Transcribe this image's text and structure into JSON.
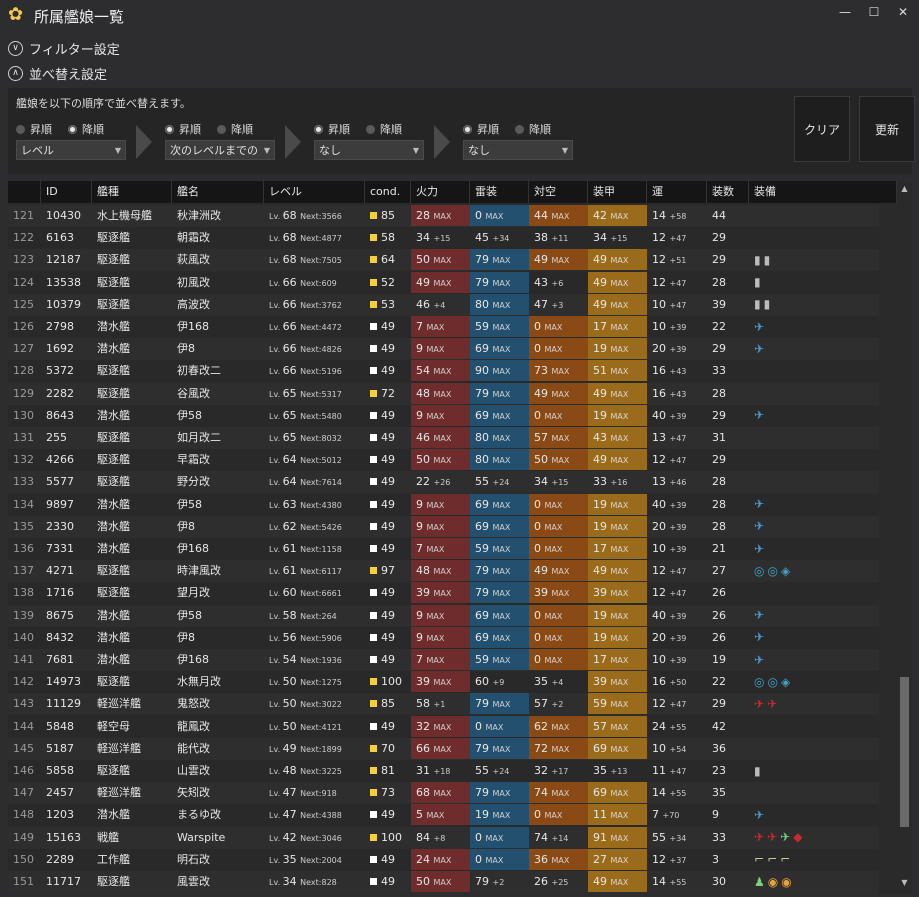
{
  "window": {
    "title": "所属艦娘一覧",
    "minimize": "—",
    "maximize": "☐",
    "close": "✕"
  },
  "filter_section": {
    "toggle": "∨",
    "label": "フィルター設定"
  },
  "sort_section": {
    "toggle": "∧",
    "label": "並べ替え設定",
    "description": "艦娘を以下の順序で並べ替えます。",
    "criteria": [
      {
        "asc": "昇順",
        "desc": "降順",
        "selected": "desc",
        "value": "レベル"
      },
      {
        "asc": "昇順",
        "desc": "降順",
        "selected": "asc",
        "value": "次のレベルまでの"
      },
      {
        "asc": "昇順",
        "desc": "降順",
        "selected": "asc",
        "value": "なし"
      },
      {
        "asc": "昇順",
        "desc": "降順",
        "selected": "asc",
        "value": "なし"
      }
    ],
    "clear_label": "クリア",
    "update_label": "更新"
  },
  "columns": [
    "",
    "ID",
    "艦種",
    "艦名",
    "レベル",
    "cond.",
    "火力",
    "雷装",
    "対空",
    "装甲",
    "運",
    "装数",
    "装備"
  ],
  "colors": {
    "red": "#6f2c2c",
    "blue": "#23506e",
    "orange": "#8a4a15",
    "gold": "#9b6b1c",
    "cond_yellow": "#f4d03f",
    "cond_white": "#ffffff",
    "gray_icon": "#bcbcbc",
    "sub_icon": "#4a9ed6",
    "fighter_icon": "#cc2b2b",
    "radar_icon": "#3fa6c7",
    "seaplane_icon": "#7ed07e",
    "aa_icon": "#e6a23c",
    "tp_icon": "#c7c79a"
  },
  "rows": [
    {
      "no": "121",
      "id": "10430",
      "type": "水上機母艦",
      "name": "秋津洲改",
      "lv": "68",
      "next": "3566",
      "cond": "85",
      "cc": "yellow",
      "fire": "28",
      "fire_s": "MAX",
      "fire_h": "red",
      "torp": "0",
      "torp_s": "MAX",
      "torp_h": "blue",
      "aa": "44",
      "aa_s": "MAX",
      "aa_h": "orange",
      "armor": "42",
      "armor_s": "MAX",
      "armor_h": "gold",
      "luck": "14",
      "luck_s": "+58",
      "slots": "44",
      "equip": []
    },
    {
      "no": "122",
      "id": "6163",
      "type": "駆逐艦",
      "name": "朝霜改",
      "lv": "68",
      "next": "4877",
      "cond": "58",
      "cc": "yellow",
      "fire": "34",
      "fire_s": "+15",
      "fire_h": "",
      "torp": "45",
      "torp_s": "+34",
      "torp_h": "",
      "aa": "38",
      "aa_s": "+11",
      "aa_h": "",
      "armor": "34",
      "armor_s": "+15",
      "armor_h": "",
      "luck": "12",
      "luck_s": "+47",
      "slots": "29",
      "equip": []
    },
    {
      "no": "123",
      "id": "12187",
      "type": "駆逐艦",
      "name": "萩風改",
      "lv": "68",
      "next": "7505",
      "cond": "64",
      "cc": "yellow",
      "fire": "50",
      "fire_s": "MAX",
      "fire_h": "red",
      "torp": "79",
      "torp_s": "MAX",
      "torp_h": "blue",
      "aa": "49",
      "aa_s": "MAX",
      "aa_h": "orange",
      "armor": "49",
      "armor_s": "MAX",
      "armor_h": "gold",
      "luck": "12",
      "luck_s": "+51",
      "slots": "29",
      "equip": [
        "drum",
        "drum"
      ]
    },
    {
      "no": "124",
      "id": "13538",
      "type": "駆逐艦",
      "name": "初風改",
      "lv": "66",
      "next": "609",
      "cond": "52",
      "cc": "yellow",
      "fire": "49",
      "fire_s": "MAX",
      "fire_h": "red",
      "torp": "79",
      "torp_s": "MAX",
      "torp_h": "blue",
      "aa": "43",
      "aa_s": "+6",
      "aa_h": "",
      "armor": "49",
      "armor_s": "MAX",
      "armor_h": "gold",
      "luck": "12",
      "luck_s": "+47",
      "slots": "28",
      "equip": [
        "drum"
      ]
    },
    {
      "no": "125",
      "id": "10379",
      "type": "駆逐艦",
      "name": "高波改",
      "lv": "66",
      "next": "3762",
      "cond": "53",
      "cc": "yellow",
      "fire": "46",
      "fire_s": "+4",
      "fire_h": "",
      "torp": "80",
      "torp_s": "MAX",
      "torp_h": "blue",
      "aa": "47",
      "aa_s": "+3",
      "aa_h": "",
      "armor": "49",
      "armor_s": "MAX",
      "armor_h": "gold",
      "luck": "10",
      "luck_s": "+47",
      "slots": "39",
      "equip": [
        "drum",
        "drum"
      ]
    },
    {
      "no": "126",
      "id": "2798",
      "type": "潜水艦",
      "name": "伊168",
      "lv": "66",
      "next": "4472",
      "cond": "49",
      "cc": "white",
      "fire": "7",
      "fire_s": "MAX",
      "fire_h": "red",
      "torp": "59",
      "torp_s": "MAX",
      "torp_h": "blue",
      "aa": "0",
      "aa_s": "MAX",
      "aa_h": "orange",
      "armor": "17",
      "armor_s": "MAX",
      "armor_h": "gold",
      "luck": "10",
      "luck_s": "+39",
      "slots": "22",
      "equip": [
        "sub"
      ]
    },
    {
      "no": "127",
      "id": "1692",
      "type": "潜水艦",
      "name": "伊8",
      "lv": "66",
      "next": "4826",
      "cond": "49",
      "cc": "white",
      "fire": "9",
      "fire_s": "MAX",
      "fire_h": "red",
      "torp": "69",
      "torp_s": "MAX",
      "torp_h": "blue",
      "aa": "0",
      "aa_s": "MAX",
      "aa_h": "orange",
      "armor": "19",
      "armor_s": "MAX",
      "armor_h": "gold",
      "luck": "20",
      "luck_s": "+39",
      "slots": "29",
      "equip": [
        "sub"
      ]
    },
    {
      "no": "128",
      "id": "5372",
      "type": "駆逐艦",
      "name": "初春改二",
      "lv": "66",
      "next": "5196",
      "cond": "49",
      "cc": "white",
      "fire": "54",
      "fire_s": "MAX",
      "fire_h": "red",
      "torp": "90",
      "torp_s": "MAX",
      "torp_h": "blue",
      "aa": "73",
      "aa_s": "MAX",
      "aa_h": "orange",
      "armor": "51",
      "armor_s": "MAX",
      "armor_h": "gold",
      "luck": "16",
      "luck_s": "+43",
      "slots": "33",
      "equip": []
    },
    {
      "no": "129",
      "id": "2282",
      "type": "駆逐艦",
      "name": "谷風改",
      "lv": "65",
      "next": "5317",
      "cond": "72",
      "cc": "yellow",
      "fire": "48",
      "fire_s": "MAX",
      "fire_h": "red",
      "torp": "79",
      "torp_s": "MAX",
      "torp_h": "blue",
      "aa": "49",
      "aa_s": "MAX",
      "aa_h": "orange",
      "armor": "49",
      "armor_s": "MAX",
      "armor_h": "gold",
      "luck": "16",
      "luck_s": "+43",
      "slots": "28",
      "equip": []
    },
    {
      "no": "130",
      "id": "8643",
      "type": "潜水艦",
      "name": "伊58",
      "lv": "65",
      "next": "5480",
      "cond": "49",
      "cc": "white",
      "fire": "9",
      "fire_s": "MAX",
      "fire_h": "red",
      "torp": "69",
      "torp_s": "MAX",
      "torp_h": "blue",
      "aa": "0",
      "aa_s": "MAX",
      "aa_h": "orange",
      "armor": "19",
      "armor_s": "MAX",
      "armor_h": "gold",
      "luck": "40",
      "luck_s": "+39",
      "slots": "29",
      "equip": [
        "sub"
      ]
    },
    {
      "no": "131",
      "id": "255",
      "type": "駆逐艦",
      "name": "如月改二",
      "lv": "65",
      "next": "8032",
      "cond": "49",
      "cc": "white",
      "fire": "46",
      "fire_s": "MAX",
      "fire_h": "red",
      "torp": "80",
      "torp_s": "MAX",
      "torp_h": "blue",
      "aa": "57",
      "aa_s": "MAX",
      "aa_h": "orange",
      "armor": "43",
      "armor_s": "MAX",
      "armor_h": "gold",
      "luck": "13",
      "luck_s": "+47",
      "slots": "31",
      "equip": []
    },
    {
      "no": "132",
      "id": "4266",
      "type": "駆逐艦",
      "name": "早霜改",
      "lv": "64",
      "next": "5012",
      "cond": "49",
      "cc": "white",
      "fire": "50",
      "fire_s": "MAX",
      "fire_h": "red",
      "torp": "80",
      "torp_s": "MAX",
      "torp_h": "blue",
      "aa": "50",
      "aa_s": "MAX",
      "aa_h": "orange",
      "armor": "49",
      "armor_s": "MAX",
      "armor_h": "gold",
      "luck": "12",
      "luck_s": "+47",
      "slots": "29",
      "equip": []
    },
    {
      "no": "133",
      "id": "5577",
      "type": "駆逐艦",
      "name": "野分改",
      "lv": "64",
      "next": "7614",
      "cond": "49",
      "cc": "white",
      "fire": "22",
      "fire_s": "+26",
      "fire_h": "",
      "torp": "55",
      "torp_s": "+24",
      "torp_h": "",
      "aa": "34",
      "aa_s": "+15",
      "aa_h": "",
      "armor": "33",
      "armor_s": "+16",
      "armor_h": "",
      "luck": "13",
      "luck_s": "+46",
      "slots": "28",
      "equip": []
    },
    {
      "no": "134",
      "id": "9897",
      "type": "潜水艦",
      "name": "伊58",
      "lv": "63",
      "next": "4380",
      "cond": "49",
      "cc": "white",
      "fire": "9",
      "fire_s": "MAX",
      "fire_h": "red",
      "torp": "69",
      "torp_s": "MAX",
      "torp_h": "blue",
      "aa": "0",
      "aa_s": "MAX",
      "aa_h": "orange",
      "armor": "19",
      "armor_s": "MAX",
      "armor_h": "gold",
      "luck": "40",
      "luck_s": "+39",
      "slots": "28",
      "equip": [
        "sub"
      ]
    },
    {
      "no": "135",
      "id": "2330",
      "type": "潜水艦",
      "name": "伊8",
      "lv": "62",
      "next": "5426",
      "cond": "49",
      "cc": "white",
      "fire": "9",
      "fire_s": "MAX",
      "fire_h": "red",
      "torp": "69",
      "torp_s": "MAX",
      "torp_h": "blue",
      "aa": "0",
      "aa_s": "MAX",
      "aa_h": "orange",
      "armor": "19",
      "armor_s": "MAX",
      "armor_h": "gold",
      "luck": "20",
      "luck_s": "+39",
      "slots": "28",
      "equip": [
        "sub"
      ]
    },
    {
      "no": "136",
      "id": "7331",
      "type": "潜水艦",
      "name": "伊168",
      "lv": "61",
      "next": "1158",
      "cond": "49",
      "cc": "white",
      "fire": "7",
      "fire_s": "MAX",
      "fire_h": "red",
      "torp": "59",
      "torp_s": "MAX",
      "torp_h": "blue",
      "aa": "0",
      "aa_s": "MAX",
      "aa_h": "orange",
      "armor": "17",
      "armor_s": "MAX",
      "armor_h": "gold",
      "luck": "10",
      "luck_s": "+39",
      "slots": "21",
      "equip": [
        "sub"
      ]
    },
    {
      "no": "137",
      "id": "4271",
      "type": "駆逐艦",
      "name": "時津風改",
      "lv": "61",
      "next": "6117",
      "cond": "97",
      "cc": "yellow",
      "fire": "48",
      "fire_s": "MAX",
      "fire_h": "red",
      "torp": "79",
      "torp_s": "MAX",
      "torp_h": "blue",
      "aa": "49",
      "aa_s": "MAX",
      "aa_h": "orange",
      "armor": "49",
      "armor_s": "MAX",
      "armor_h": "gold",
      "luck": "12",
      "luck_s": "+47",
      "slots": "27",
      "equip": [
        "radar",
        "radar",
        "sonar"
      ]
    },
    {
      "no": "138",
      "id": "1716",
      "type": "駆逐艦",
      "name": "望月改",
      "lv": "60",
      "next": "6661",
      "cond": "49",
      "cc": "white",
      "fire": "39",
      "fire_s": "MAX",
      "fire_h": "red",
      "torp": "79",
      "torp_s": "MAX",
      "torp_h": "blue",
      "aa": "39",
      "aa_s": "MAX",
      "aa_h": "orange",
      "armor": "39",
      "armor_s": "MAX",
      "armor_h": "gold",
      "luck": "12",
      "luck_s": "+47",
      "slots": "26",
      "equip": []
    },
    {
      "no": "139",
      "id": "8675",
      "type": "潜水艦",
      "name": "伊58",
      "lv": "58",
      "next": "264",
      "cond": "49",
      "cc": "white",
      "fire": "9",
      "fire_s": "MAX",
      "fire_h": "red",
      "torp": "69",
      "torp_s": "MAX",
      "torp_h": "blue",
      "aa": "0",
      "aa_s": "MAX",
      "aa_h": "orange",
      "armor": "19",
      "armor_s": "MAX",
      "armor_h": "gold",
      "luck": "40",
      "luck_s": "+39",
      "slots": "26",
      "equip": [
        "sub"
      ]
    },
    {
      "no": "140",
      "id": "8432",
      "type": "潜水艦",
      "name": "伊8",
      "lv": "56",
      "next": "5906",
      "cond": "49",
      "cc": "white",
      "fire": "9",
      "fire_s": "MAX",
      "fire_h": "red",
      "torp": "69",
      "torp_s": "MAX",
      "torp_h": "blue",
      "aa": "0",
      "aa_s": "MAX",
      "aa_h": "orange",
      "armor": "19",
      "armor_s": "MAX",
      "armor_h": "gold",
      "luck": "20",
      "luck_s": "+39",
      "slots": "26",
      "equip": [
        "sub"
      ]
    },
    {
      "no": "141",
      "id": "7681",
      "type": "潜水艦",
      "name": "伊168",
      "lv": "54",
      "next": "1936",
      "cond": "49",
      "cc": "white",
      "fire": "7",
      "fire_s": "MAX",
      "fire_h": "red",
      "torp": "59",
      "torp_s": "MAX",
      "torp_h": "blue",
      "aa": "0",
      "aa_s": "MAX",
      "aa_h": "orange",
      "armor": "17",
      "armor_s": "MAX",
      "armor_h": "gold",
      "luck": "10",
      "luck_s": "+39",
      "slots": "19",
      "equip": [
        "sub"
      ]
    },
    {
      "no": "142",
      "id": "14973",
      "type": "駆逐艦",
      "name": "水無月改",
      "lv": "50",
      "next": "1275",
      "cond": "100",
      "cc": "yellow",
      "fire": "39",
      "fire_s": "MAX",
      "fire_h": "red",
      "torp": "60",
      "torp_s": "+9",
      "torp_h": "",
      "aa": "35",
      "aa_s": "+4",
      "aa_h": "",
      "armor": "39",
      "armor_s": "MAX",
      "armor_h": "gold",
      "luck": "16",
      "luck_s": "+50",
      "slots": "22",
      "equip": [
        "radar",
        "radar",
        "sonar"
      ]
    },
    {
      "no": "143",
      "id": "11129",
      "type": "軽巡洋艦",
      "name": "鬼怒改",
      "lv": "50",
      "next": "3022",
      "cond": "85",
      "cc": "yellow",
      "fire": "58",
      "fire_s": "+1",
      "fire_h": "",
      "torp": "79",
      "torp_s": "MAX",
      "torp_h": "blue",
      "aa": "57",
      "aa_s": "+2",
      "aa_h": "",
      "armor": "59",
      "armor_s": "MAX",
      "armor_h": "gold",
      "luck": "12",
      "luck_s": "+47",
      "slots": "29",
      "equip": [
        "fighter",
        "fighter"
      ]
    },
    {
      "no": "144",
      "id": "5848",
      "type": "軽空母",
      "name": "龍鳳改",
      "lv": "50",
      "next": "4121",
      "cond": "49",
      "cc": "white",
      "fire": "32",
      "fire_s": "MAX",
      "fire_h": "red",
      "torp": "0",
      "torp_s": "MAX",
      "torp_h": "blue",
      "aa": "62",
      "aa_s": "MAX",
      "aa_h": "orange",
      "armor": "57",
      "armor_s": "MAX",
      "armor_h": "gold",
      "luck": "24",
      "luck_s": "+55",
      "slots": "42",
      "equip": []
    },
    {
      "no": "145",
      "id": "5187",
      "type": "軽巡洋艦",
      "name": "能代改",
      "lv": "49",
      "next": "1899",
      "cond": "70",
      "cc": "yellow",
      "fire": "66",
      "fire_s": "MAX",
      "fire_h": "red",
      "torp": "79",
      "torp_s": "MAX",
      "torp_h": "blue",
      "aa": "72",
      "aa_s": "MAX",
      "aa_h": "orange",
      "armor": "69",
      "armor_s": "MAX",
      "armor_h": "gold",
      "luck": "10",
      "luck_s": "+54",
      "slots": "36",
      "equip": []
    },
    {
      "no": "146",
      "id": "5858",
      "type": "駆逐艦",
      "name": "山雲改",
      "lv": "48",
      "next": "3225",
      "cond": "81",
      "cc": "yellow",
      "fire": "31",
      "fire_s": "+18",
      "fire_h": "",
      "torp": "55",
      "torp_s": "+24",
      "torp_h": "",
      "aa": "32",
      "aa_s": "+17",
      "aa_h": "",
      "armor": "35",
      "armor_s": "+13",
      "armor_h": "",
      "luck": "11",
      "luck_s": "+47",
      "slots": "23",
      "equip": [
        "drum"
      ]
    },
    {
      "no": "147",
      "id": "2457",
      "type": "軽巡洋艦",
      "name": "矢矧改",
      "lv": "47",
      "next": "918",
      "cond": "73",
      "cc": "yellow",
      "fire": "68",
      "fire_s": "MAX",
      "fire_h": "red",
      "torp": "79",
      "torp_s": "MAX",
      "torp_h": "blue",
      "aa": "74",
      "aa_s": "MAX",
      "aa_h": "orange",
      "armor": "69",
      "armor_s": "MAX",
      "armor_h": "gold",
      "luck": "14",
      "luck_s": "+55",
      "slots": "35",
      "equip": []
    },
    {
      "no": "148",
      "id": "1203",
      "type": "潜水艦",
      "name": "まるゆ改",
      "lv": "47",
      "next": "4388",
      "cond": "49",
      "cc": "white",
      "fire": "5",
      "fire_s": "MAX",
      "fire_h": "red",
      "torp": "19",
      "torp_s": "MAX",
      "torp_h": "blue",
      "aa": "0",
      "aa_s": "MAX",
      "aa_h": "orange",
      "armor": "11",
      "armor_s": "MAX",
      "armor_h": "gold",
      "luck": "7",
      "luck_s": "+70",
      "slots": "9",
      "equip": [
        "sub"
      ]
    },
    {
      "no": "149",
      "id": "15163",
      "type": "戦艦",
      "name": "Warspite",
      "lv": "42",
      "next": "3046",
      "cond": "100",
      "cc": "yellow",
      "fire": "84",
      "fire_s": "+8",
      "fire_h": "",
      "torp": "0",
      "torp_s": "MAX",
      "torp_h": "blue",
      "aa": "74",
      "aa_s": "+14",
      "aa_h": "",
      "armor": "91",
      "armor_s": "MAX",
      "armor_h": "gold",
      "luck": "55",
      "luck_s": "+34",
      "slots": "33",
      "equip": [
        "fighter",
        "fighter",
        "seaplane",
        "shell"
      ]
    },
    {
      "no": "150",
      "id": "2289",
      "type": "工作艦",
      "name": "明石改",
      "lv": "35",
      "next": "2004",
      "cond": "49",
      "cc": "white",
      "fire": "24",
      "fire_s": "MAX",
      "fire_h": "red",
      "torp": "0",
      "torp_s": "MAX",
      "torp_h": "blue",
      "aa": "36",
      "aa_s": "MAX",
      "aa_h": "orange",
      "armor": "27",
      "armor_s": "MAX",
      "armor_h": "gold",
      "luck": "12",
      "luck_s": "+37",
      "slots": "3",
      "equip": [
        "crane",
        "crane",
        "crane"
      ]
    },
    {
      "no": "151",
      "id": "11717",
      "type": "駆逐艦",
      "name": "風雲改",
      "lv": "34",
      "next": "828",
      "cond": "49",
      "cc": "white",
      "fire": "50",
      "fire_s": "MAX",
      "fire_h": "red",
      "torp": "79",
      "torp_s": "+2",
      "torp_h": "",
      "aa": "26",
      "aa_s": "+25",
      "aa_h": "",
      "armor": "49",
      "armor_s": "MAX",
      "armor_h": "gold",
      "luck": "14",
      "luck_s": "+55",
      "slots": "30",
      "equip": [
        "lookout",
        "aagun",
        "aagun"
      ]
    }
  ]
}
